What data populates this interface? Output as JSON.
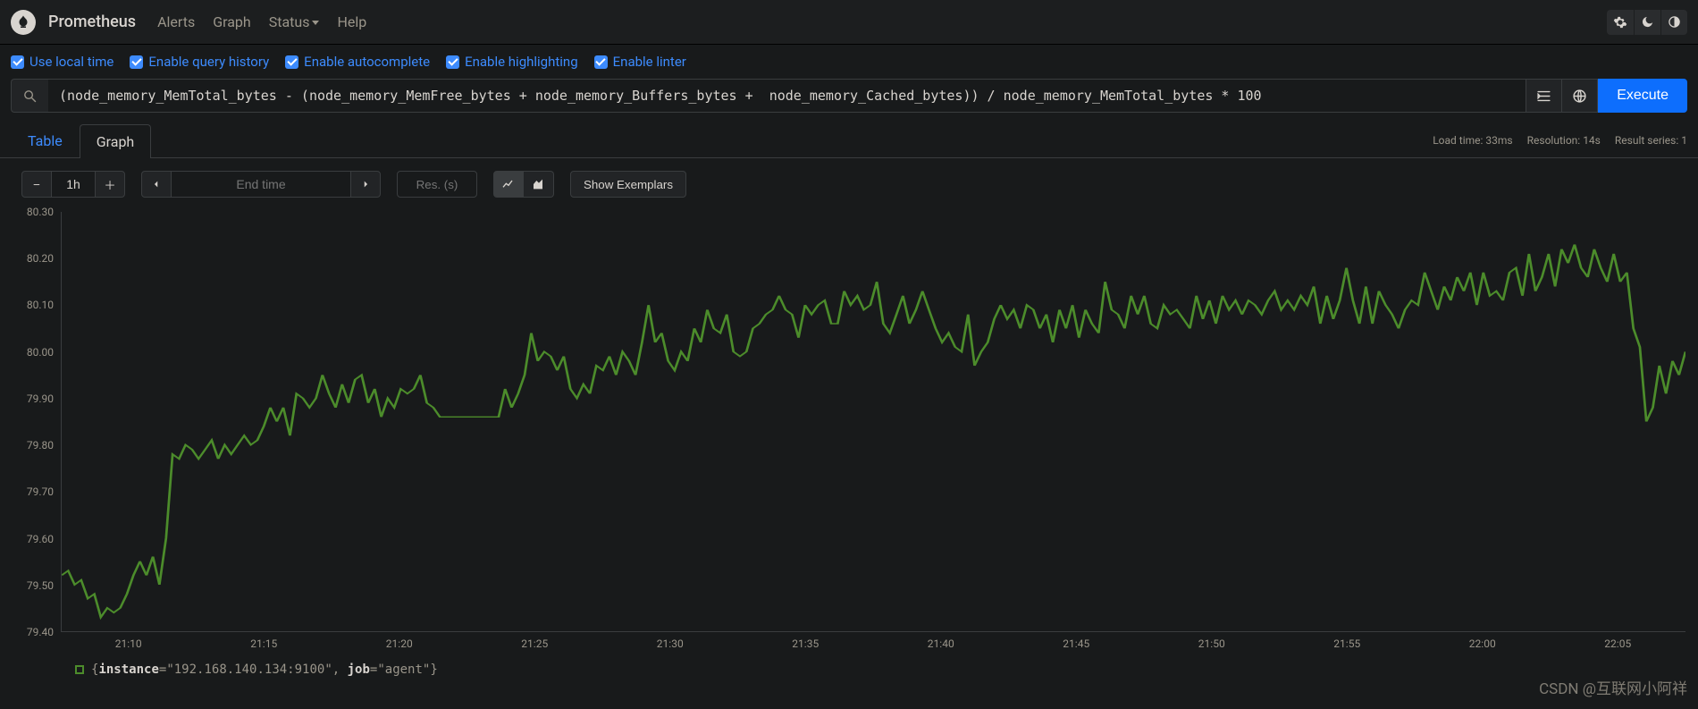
{
  "navbar": {
    "brand": "Prometheus",
    "alerts": "Alerts",
    "graph": "Graph",
    "status": "Status",
    "help": "Help"
  },
  "options": {
    "use_local_time": "Use local time",
    "enable_history": "Enable query history",
    "enable_autocomplete": "Enable autocomplete",
    "enable_highlighting": "Enable highlighting",
    "enable_linter": "Enable linter"
  },
  "query": {
    "expression": "(node_memory_MemTotal_bytes - (node_memory_MemFree_bytes + node_memory_Buffers_bytes +  node_memory_Cached_bytes)) / node_memory_MemTotal_bytes * 100",
    "execute_label": "Execute"
  },
  "status": {
    "load_label": "Load time:",
    "load_value": "33ms",
    "res_label": "Resolution:",
    "res_value": "14s",
    "result_label": "Result series:",
    "result_value": "1"
  },
  "tabs": {
    "table": "Table",
    "graph": "Graph"
  },
  "controls": {
    "range": "1h",
    "end_time_placeholder": "End time",
    "res_placeholder": "Res. (s)",
    "show_exemplars": "Show Exemplars"
  },
  "legend": {
    "instance_key": "instance",
    "instance_val": "\"192.168.140.134:9100\"",
    "job_key": "job",
    "job_val": "\"agent\""
  },
  "watermark": "CSDN @互联网小阿祥",
  "chart_data": {
    "type": "line",
    "xlabel": "",
    "ylabel": "",
    "ylim": [
      79.4,
      80.3
    ],
    "x_categories": [
      "21:10",
      "21:15",
      "21:20",
      "21:25",
      "21:30",
      "21:35",
      "21:40",
      "21:45",
      "21:50",
      "21:55",
      "22:00",
      "22:05"
    ],
    "y_ticks": [
      79.4,
      79.5,
      79.6,
      79.7,
      79.8,
      79.9,
      80.0,
      80.1,
      80.2,
      80.3
    ],
    "series": [
      {
        "name": "{instance=\"192.168.140.134:9100\", job=\"agent\"}",
        "color": "#4c8c2b",
        "x": [
          0,
          1,
          2,
          3,
          4,
          5,
          6,
          7,
          8,
          9,
          10,
          11,
          12,
          13,
          14,
          15,
          16,
          17,
          18,
          19,
          20,
          21,
          22,
          23,
          24,
          25,
          26,
          27,
          28,
          29,
          30,
          31,
          32,
          33,
          34,
          35,
          36,
          37,
          38,
          39,
          40,
          41,
          42,
          43,
          44,
          45,
          46,
          47,
          48,
          49,
          50,
          51,
          52,
          53,
          54,
          55,
          56,
          57,
          58,
          59,
          60,
          61,
          62,
          63,
          64,
          65,
          66,
          67,
          68,
          69,
          70,
          71,
          72,
          73,
          74,
          75,
          76,
          77,
          78,
          79,
          80,
          81,
          82,
          83,
          84,
          85,
          86,
          87,
          88,
          89,
          90,
          91,
          92,
          93,
          94,
          95,
          96,
          97,
          98,
          99,
          100,
          101,
          102,
          103,
          104,
          105,
          106,
          107,
          108,
          109,
          110,
          111,
          112,
          113,
          114,
          115,
          116,
          117,
          118,
          119,
          120,
          121,
          122,
          123,
          124,
          125,
          126,
          127,
          128,
          129,
          130,
          131,
          132,
          133,
          134,
          135,
          136,
          137,
          138,
          139,
          140,
          141,
          142,
          143,
          144,
          145,
          146,
          147,
          148,
          149,
          150,
          151,
          152,
          153,
          154,
          155,
          156,
          157,
          158,
          159,
          160,
          161,
          162,
          163,
          164,
          165,
          166,
          167,
          168,
          169,
          170,
          171,
          172,
          173,
          174,
          175,
          176,
          177,
          178,
          179,
          180,
          181,
          182,
          183,
          184,
          185,
          186,
          187,
          188,
          189,
          190,
          191,
          192,
          193,
          194,
          195,
          196,
          197,
          198,
          199,
          200,
          201,
          202,
          203,
          204,
          205,
          206,
          207,
          208,
          209,
          210,
          211,
          212,
          213,
          214,
          215,
          216,
          217,
          218,
          219,
          220,
          221,
          222,
          223,
          224,
          225,
          226,
          227,
          228,
          229,
          230,
          231,
          232,
          233,
          234,
          235,
          236,
          237,
          238,
          239,
          240,
          241,
          242,
          243,
          244,
          245,
          246,
          247,
          248,
          249
        ],
        "values": [
          79.52,
          79.53,
          79.5,
          79.51,
          79.47,
          79.48,
          79.43,
          79.45,
          79.44,
          79.45,
          79.48,
          79.52,
          79.55,
          79.52,
          79.56,
          79.5,
          79.6,
          79.78,
          79.77,
          79.8,
          79.79,
          79.77,
          79.79,
          79.81,
          79.77,
          79.8,
          79.78,
          79.8,
          79.82,
          79.8,
          79.81,
          79.84,
          79.88,
          79.85,
          79.88,
          79.82,
          79.91,
          79.9,
          79.88,
          79.9,
          79.95,
          79.91,
          79.88,
          79.93,
          79.89,
          79.94,
          79.95,
          79.89,
          79.92,
          79.86,
          79.9,
          79.88,
          79.92,
          79.91,
          79.92,
          79.95,
          79.89,
          79.88,
          79.86,
          79.86,
          79.86,
          79.86,
          79.86,
          79.86,
          79.86,
          79.86,
          79.86,
          79.86,
          79.92,
          79.88,
          79.91,
          79.95,
          80.04,
          79.98,
          80.0,
          79.99,
          79.96,
          79.99,
          79.92,
          79.9,
          79.93,
          79.91,
          79.97,
          79.96,
          79.99,
          79.95,
          80.0,
          79.98,
          79.95,
          80.02,
          80.1,
          80.02,
          80.04,
          79.98,
          79.96,
          80.0,
          79.98,
          80.05,
          80.02,
          80.09,
          80.05,
          80.04,
          80.08,
          80.0,
          79.99,
          80.0,
          80.05,
          80.06,
          80.08,
          80.09,
          80.12,
          80.09,
          80.08,
          80.03,
          80.1,
          80.08,
          80.1,
          80.11,
          80.06,
          80.06,
          80.13,
          80.1,
          80.12,
          80.09,
          80.1,
          80.15,
          80.06,
          80.04,
          80.08,
          80.12,
          80.06,
          80.09,
          80.13,
          80.09,
          80.05,
          80.02,
          80.04,
          80.01,
          80.0,
          80.08,
          79.97,
          80.0,
          80.02,
          80.07,
          80.1,
          80.07,
          80.09,
          80.05,
          80.1,
          80.09,
          80.05,
          80.08,
          80.02,
          80.09,
          80.05,
          80.1,
          80.03,
          80.09,
          80.06,
          80.04,
          80.15,
          80.09,
          80.08,
          80.05,
          80.12,
          80.08,
          80.12,
          80.06,
          80.05,
          80.1,
          80.08,
          80.09,
          80.07,
          80.05,
          80.12,
          80.07,
          80.11,
          80.06,
          80.12,
          80.09,
          80.11,
          80.08,
          80.11,
          80.1,
          80.08,
          80.11,
          80.13,
          80.09,
          80.11,
          80.09,
          80.12,
          80.1,
          80.14,
          80.06,
          80.12,
          80.07,
          80.11,
          80.18,
          80.11,
          80.06,
          80.14,
          80.06,
          80.13,
          80.1,
          80.08,
          80.05,
          80.09,
          80.11,
          80.1,
          80.17,
          80.13,
          80.09,
          80.14,
          80.11,
          80.16,
          80.13,
          80.17,
          80.1,
          80.17,
          80.12,
          80.13,
          80.11,
          80.17,
          80.18,
          80.12,
          80.21,
          80.13,
          80.16,
          80.21,
          80.14,
          80.22,
          80.19,
          80.23,
          80.18,
          80.16,
          80.22,
          80.18,
          80.15,
          80.21,
          80.15,
          80.17,
          80.05,
          80.01,
          79.85,
          79.88,
          79.97,
          79.91,
          79.98,
          79.95,
          80.0
        ]
      }
    ]
  }
}
